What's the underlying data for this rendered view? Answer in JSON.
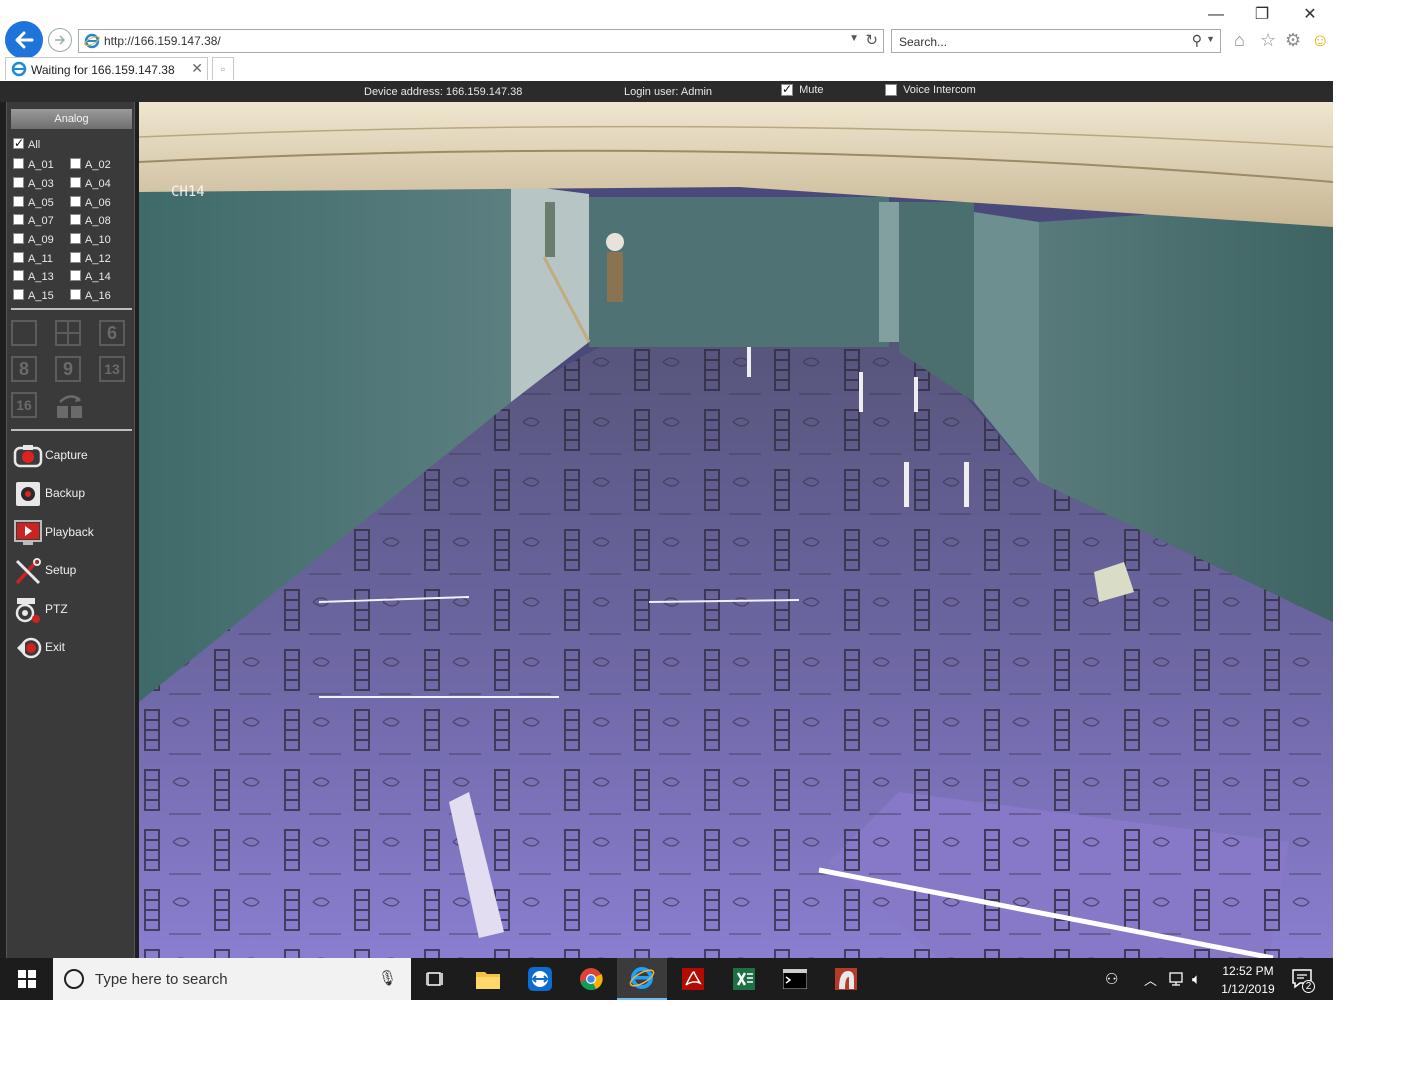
{
  "browser": {
    "url": "http://166.159.147.38/",
    "search_placeholder": "Search...",
    "tab_title": "Waiting for 166.159.147.38"
  },
  "status": {
    "device_address": "Device address: 166.159.147.38",
    "login_user": "Login user: Admin",
    "mute_label": "Mute",
    "mute_checked": true,
    "voice_label": "Voice Intercom",
    "voice_checked": false
  },
  "panel": {
    "header": "Analog",
    "all_label": "All",
    "channels": [
      "A_01",
      "A_02",
      "A_03",
      "A_04",
      "A_05",
      "A_06",
      "A_07",
      "A_08",
      "A_09",
      "A_10",
      "A_11",
      "A_12",
      "A_13",
      "A_14",
      "A_15",
      "A_16"
    ],
    "layouts": [
      "",
      "",
      "6",
      "8",
      "9",
      "13",
      "16",
      ""
    ],
    "menu": [
      "Capture",
      "Backup",
      "Playback",
      "Setup",
      "PTZ",
      "Exit"
    ]
  },
  "camera": {
    "channel_label": "CH14"
  },
  "taskbar": {
    "search_placeholder": "Type here to search",
    "time": "12:52 PM",
    "date": "1/12/2019",
    "notification_count": "2"
  },
  "colors": {
    "ie_blue": "#1e74d8",
    "statusbar_bg": "#2b2b2b",
    "panel_bg": "#3a3a3a",
    "taskbar_bg": "#1c1c1c"
  }
}
